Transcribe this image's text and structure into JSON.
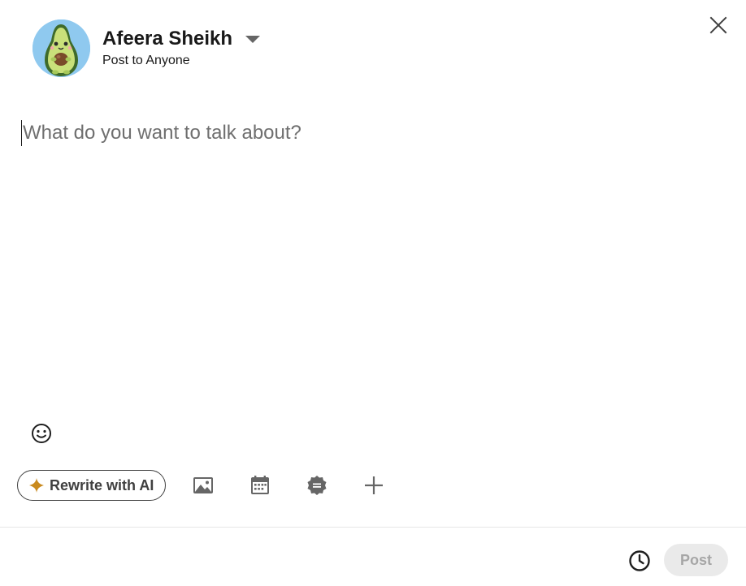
{
  "header": {
    "author_name": "Afeera Sheikh",
    "audience": "Post to Anyone",
    "avatar_icon": "avocado-avatar-icon",
    "dropdown_icon": "caret-down-icon"
  },
  "editor": {
    "placeholder": "What do you want to talk about?",
    "value": ""
  },
  "toolbar": {
    "ai_button_label": "Rewrite with AI",
    "ai_icon": "sparkle-icon",
    "tools": [
      {
        "name": "media",
        "icon": "image-icon"
      },
      {
        "name": "event",
        "icon": "calendar-icon"
      },
      {
        "name": "celebrate",
        "icon": "badge-icon"
      },
      {
        "name": "more",
        "icon": "plus-icon"
      }
    ]
  },
  "footer": {
    "schedule_icon": "clock-icon",
    "post_label": "Post",
    "post_enabled": false
  },
  "colors": {
    "accent_sparkle": "#c98a1e",
    "avatar_background": "#8fc9ef",
    "post_disabled_bg": "#eaeaea",
    "post_disabled_text": "#a6a6a6"
  }
}
